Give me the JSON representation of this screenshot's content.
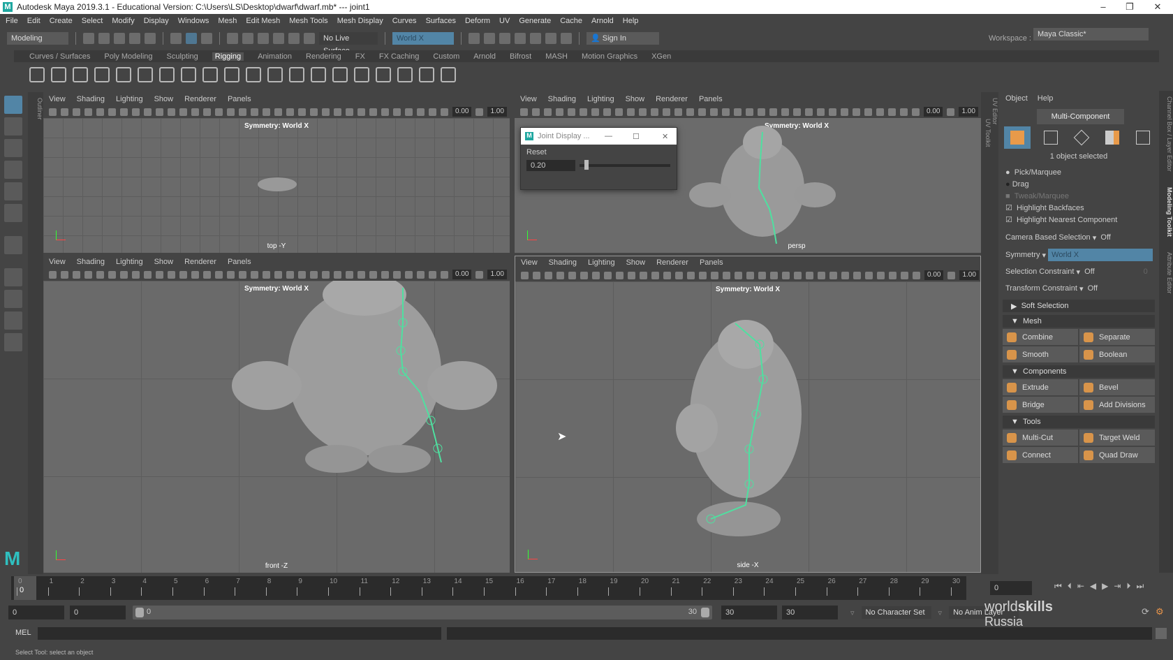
{
  "window": {
    "title": "Autodesk Maya 2019.3.1 - Educational Version: C:\\Users\\LS\\Desktop\\dwarf\\dwarf.mb*  ---  joint1",
    "logo": "M"
  },
  "menu": [
    "File",
    "Edit",
    "Create",
    "Select",
    "Modify",
    "Display",
    "Windows",
    "Mesh",
    "Edit Mesh",
    "Mesh Tools",
    "Mesh Display",
    "Curves",
    "Surfaces",
    "Deform",
    "UV",
    "Generate",
    "Cache",
    "Arnold",
    "Help"
  ],
  "status": {
    "menuset": "Modeling",
    "live_surface": "No Live Surface",
    "symmetry": "World X",
    "sign_in": "Sign In",
    "workspace_label": "Workspace :",
    "workspace": "Maya Classic*"
  },
  "shelf": {
    "tabs": [
      "Curves / Surfaces",
      "Poly Modeling",
      "Sculpting",
      "Rigging",
      "Animation",
      "Rendering",
      "FX",
      "FX Caching",
      "Custom",
      "Arnold",
      "Bifrost",
      "MASH",
      "Motion Graphics",
      "XGen"
    ],
    "active": "Rigging"
  },
  "side_tabs": {
    "outliner": "Outliner",
    "uv_editor": "UV Editor",
    "uv_toolkit": "UV Toolkit",
    "channel_box": "Channel Box / Layer Editor",
    "modeling_toolkit": "Modeling Toolkit",
    "attribute_editor": "Attribute Editor"
  },
  "viewport": {
    "menu": [
      "View",
      "Shading",
      "Lighting",
      "Show",
      "Renderer",
      "Panels"
    ],
    "val1": "0.00",
    "val2": "1.00",
    "symmetry": "Symmetry: World X",
    "cameras": {
      "top": "top -Y",
      "persp": "persp",
      "front": "front -Z",
      "side": "side -X"
    }
  },
  "joint_dialog": {
    "title": "Joint Display ...",
    "reset": "Reset",
    "value": "0.20",
    "slider_fraction": 0.05
  },
  "toolkit": {
    "menu": [
      "Object",
      "Help"
    ],
    "mode": "Multi-Component",
    "selected": "1 object selected",
    "radios": [
      "Pick/Marquee",
      "Drag",
      "Tweak/Marquee"
    ],
    "checks": [
      "Highlight Backfaces",
      "Highlight Nearest Component"
    ],
    "camera_sel": {
      "label": "Camera Based Selection",
      "value": "Off"
    },
    "symmetry": {
      "label": "Symmetry",
      "value": "World X"
    },
    "sel_constraint": {
      "label": "Selection Constraint",
      "value": "Off",
      "num": "0"
    },
    "xform_constraint": {
      "label": "Transform Constraint",
      "value": "Off"
    },
    "soft_selection": "Soft Selection",
    "sections": [
      {
        "title": "Mesh",
        "buttons": [
          "Combine",
          "Separate",
          "Smooth",
          "Boolean"
        ]
      },
      {
        "title": "Components",
        "buttons": [
          "Extrude",
          "Bevel",
          "Bridge",
          "Add Divisions"
        ]
      },
      {
        "title": "Tools",
        "buttons": [
          "Multi-Cut",
          "Target Weld",
          "Connect",
          "Quad Draw"
        ]
      }
    ],
    "accent": "#5285a6",
    "icon_color": "#d8944a"
  },
  "timeline": {
    "ticks": [
      "0",
      "1",
      "2",
      "3",
      "4",
      "5",
      "6",
      "7",
      "8",
      "9",
      "10",
      "11",
      "12",
      "13",
      "14",
      "15",
      "16",
      "17",
      "18",
      "19",
      "20",
      "21",
      "22",
      "23",
      "24",
      "25",
      "26",
      "27",
      "28",
      "29",
      "30"
    ],
    "current": "0",
    "current_field": "0"
  },
  "range": {
    "start": "0",
    "inner_start": "0",
    "slider_start": "0",
    "slider_end": "30",
    "end": "30",
    "outer_end": "30",
    "character_set": "No Character Set",
    "anim_layer": "No Anim Layer"
  },
  "command": {
    "label": "MEL",
    "help": "Select Tool: select an object"
  },
  "watermark": {
    "text1": "world",
    "text2": "skills",
    "text3": "Russia"
  },
  "colors": {
    "joint": "#4fe0a0",
    "viewport_bg": "#6a6a6a",
    "panel": "#444444"
  }
}
